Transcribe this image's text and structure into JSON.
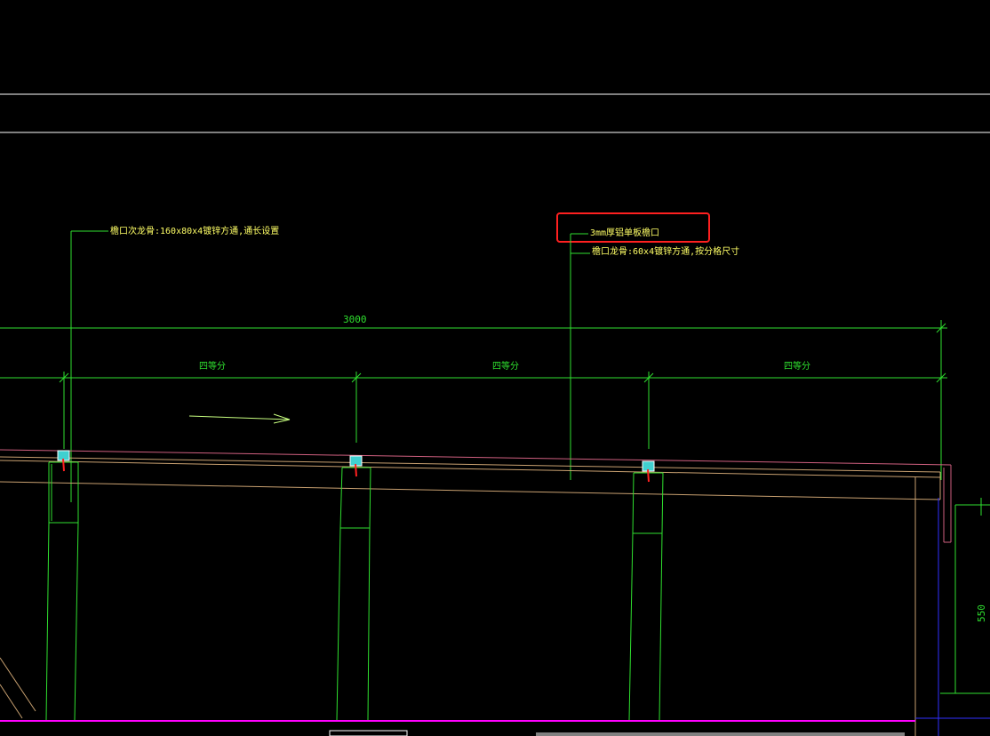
{
  "drawing": {
    "background_color": "#000000",
    "annotations": {
      "left_leader_text": "檐口次龙骨:160x80x4镀锌方通,通长设置",
      "highlight_text": "3mm厚铝单板檐口",
      "keel_text": "檐口龙骨:60x4镀锌方通,按分格尺寸"
    },
    "dimensions": {
      "overall": "3000",
      "segment_labels": [
        "四等分",
        "四等分",
        "四等分"
      ],
      "vertical": "550"
    },
    "colors": {
      "line_white": "#ffffff",
      "dim_green": "#2fe02f",
      "text_yellow": "#ffff66",
      "tan": "#c8a070",
      "pink": "#d06080",
      "magenta": "#ff00ff",
      "blue": "#3030ff",
      "highlight_red": "#ff2020",
      "connector_cyan": "#40d0d0",
      "bolt_red": "#ff2020"
    },
    "icons": {
      "arrow": "right-arrow-icon",
      "connector": "bolt-connector-icon"
    }
  }
}
